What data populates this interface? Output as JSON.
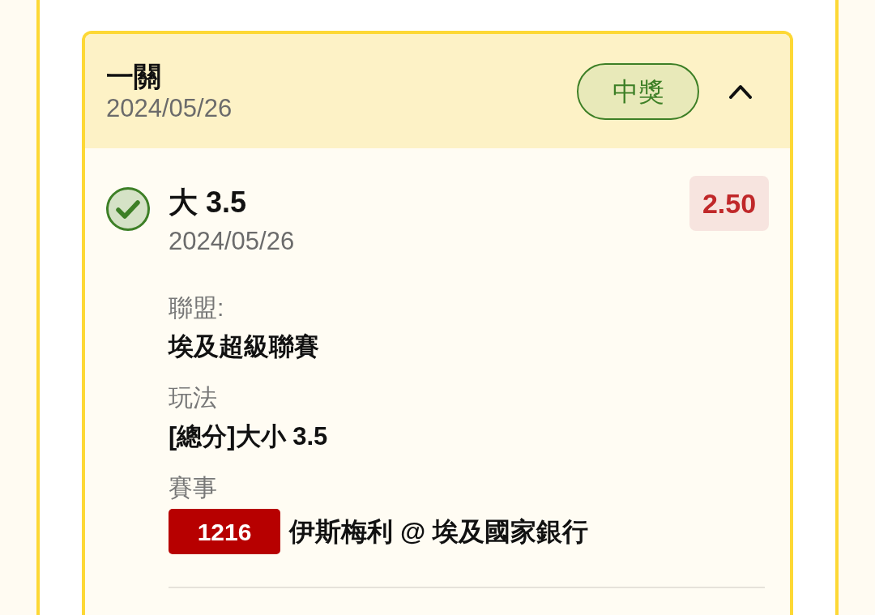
{
  "bet": {
    "title": "一關",
    "date": "2024/05/26",
    "status_label": "中獎",
    "expanded": true
  },
  "selections": [
    {
      "won": true,
      "pick": "大 3.5",
      "date": "2024/05/26",
      "odds": "2.50",
      "details": [
        {
          "kind": "text",
          "label": "聯盟:",
          "value": "埃及超級聯賽"
        },
        {
          "kind": "text",
          "label": "玩法",
          "value": "[總分]大小 3.5"
        },
        {
          "kind": "match",
          "label": "賽事",
          "match_number": "1216",
          "value": "伊斯梅利 @ 埃及國家銀行"
        }
      ]
    }
  ]
}
